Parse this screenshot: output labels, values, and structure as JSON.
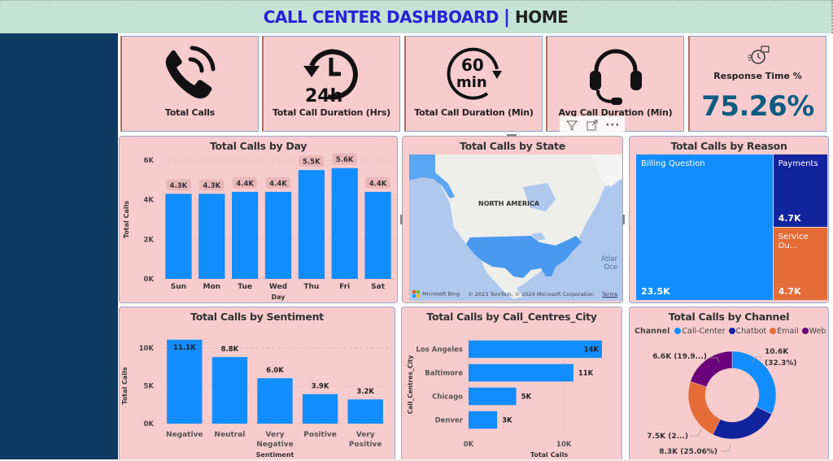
{
  "header": {
    "title": "CALL CENTER DASHBOARD",
    "separator": "|",
    "page": "HOME"
  },
  "kpis": [
    {
      "label": "Total Calls",
      "icon": "phone-ringing-icon"
    },
    {
      "label": "Total Call Duration (Hrs)",
      "icon": "clock-24h-icon"
    },
    {
      "label": "Total Call Duration (Min)",
      "icon": "timer-60min-icon"
    },
    {
      "label": "Avg Call Duration (Min)",
      "icon": "headset-icon"
    },
    {
      "label": "Response Time %",
      "icon": "stopwatch-chat-icon",
      "value": "75.26%"
    }
  ],
  "visual_header_tools": [
    {
      "name": "filter-icon",
      "glyph": "▽"
    },
    {
      "name": "focus-mode-icon",
      "glyph": "⤢"
    },
    {
      "name": "more-options-icon",
      "glyph": "···"
    }
  ],
  "map": {
    "title": "Total Calls by State",
    "region_label": "NORTH AMERICA",
    "ocean_label_1": "Atlar",
    "ocean_label_2": "Oce",
    "provider": "Microsoft Bing",
    "copyright": "© 2023 TomTom, © 2024 Microsoft Corporation",
    "terms": "Terms"
  },
  "colors": {
    "card_bg": "#f8cccc",
    "bar_blue": "#118dff",
    "dark_blue": "#12239e",
    "orange": "#e66c37",
    "purple": "#6b007b",
    "kpi_value": "#0f5c82",
    "sidebar": "#0f3a62",
    "title_bar": "#c3e3d7"
  },
  "chart_data": [
    {
      "id": "by_day",
      "type": "bar",
      "title": "Total Calls by Day",
      "xlabel": "Day",
      "ylabel": "Total Calls",
      "categories": [
        "Sun",
        "Mon",
        "Tue",
        "Wed",
        "Thu",
        "Fri",
        "Sat"
      ],
      "values": [
        4300,
        4300,
        4400,
        4400,
        5500,
        5600,
        4400
      ],
      "data_labels": [
        "4.3K",
        "4.3K",
        "4.4K",
        "4.4K",
        "5.5K",
        "5.6K",
        "4.4K"
      ],
      "yticks": [
        "0K",
        "2K",
        "4K",
        "6K"
      ],
      "ylim": [
        0,
        6000
      ],
      "grid": true
    },
    {
      "id": "by_reason",
      "type": "treemap",
      "title": "Total Calls by Reason",
      "items": [
        {
          "label": "Billing Question",
          "value": 23500,
          "display": "23.5K",
          "color": "#118dff"
        },
        {
          "label": "Payments",
          "value": 4700,
          "display": "4.7K",
          "color": "#12239e"
        },
        {
          "label": "Service Ou...",
          "value": 4700,
          "display": "4.7K",
          "color": "#e66c37"
        }
      ]
    },
    {
      "id": "by_sentiment",
      "type": "bar",
      "title": "Total Calls by Sentiment",
      "xlabel": "Sentiment",
      "ylabel": "Total Calls",
      "categories": [
        "Negative",
        "Neutral",
        "Very Negative",
        "Positive",
        "Very Positive"
      ],
      "category_lines": [
        [
          "Negative"
        ],
        [
          "Neutral"
        ],
        [
          "Very",
          "Negative"
        ],
        [
          "Positive"
        ],
        [
          "Very",
          "Positive"
        ]
      ],
      "values": [
        11100,
        8800,
        6000,
        3900,
        3200
      ],
      "data_labels": [
        "11.1K",
        "8.8K",
        "6.0K",
        "3.9K",
        "3.2K"
      ],
      "yticks": [
        "0K",
        "5K",
        "10K"
      ],
      "ylim": [
        0,
        10000
      ],
      "grid": true
    },
    {
      "id": "by_city",
      "type": "bar",
      "orientation": "horizontal",
      "title": "Total Calls by Call_Centres_City",
      "xlabel": "Total Calls",
      "ylabel": "Call_Centres_City",
      "categories": [
        "Los Angeles",
        "Baltimore",
        "Chicago",
        "Denver"
      ],
      "values": [
        14000,
        11000,
        5000,
        3000
      ],
      "data_labels": [
        "14K",
        "11K",
        "5K",
        "3K"
      ],
      "xticks": [
        "0K",
        "10K"
      ],
      "xlim": [
        0,
        14000
      ],
      "grid": true
    },
    {
      "id": "by_channel",
      "type": "pie",
      "subtype": "donut",
      "title": "Total Calls by Channel",
      "legend_title": "Channel",
      "legend_position": "top-left",
      "slices": [
        {
          "label": "Call-Center",
          "value": 10600,
          "percent": 32.3,
          "data_label_1": "10.6K",
          "data_label_2": "(32.3%)",
          "color": "#118dff"
        },
        {
          "label": "Chatbot",
          "value": 8300,
          "percent": 25.06,
          "data_label_1": "8.3K (25.06%)",
          "color": "#12239e"
        },
        {
          "label": "Email",
          "value": 7500,
          "percent": 22.7,
          "data_label_1": "7.5K (2...)",
          "color": "#e66c37"
        },
        {
          "label": "Web",
          "value": 6600,
          "percent": 19.9,
          "data_label_1": "6.6K (19.9...)",
          "color": "#6b007b"
        }
      ]
    }
  ]
}
